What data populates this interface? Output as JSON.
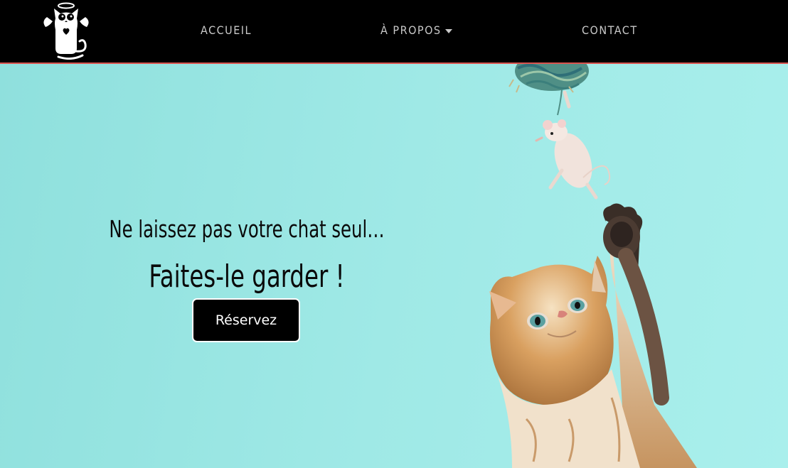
{
  "navbar": {
    "logo_icon": "angel-cat-logo-icon",
    "items": [
      {
        "label": "ACCUEIL"
      },
      {
        "label": "À PROPOS",
        "has_dropdown": true,
        "dropdown_icon": "caret-down-icon"
      },
      {
        "label": "CONTACT"
      }
    ]
  },
  "hero": {
    "tagline": "Ne laissez pas votre chat seul…",
    "headline": "Faites-le garder !",
    "cta_label": "Réservez",
    "image": "kitten-reaching-for-toy-mouse",
    "colors": {
      "background": "#95e3e0",
      "navbar": "#000000",
      "navbar_border": "#d9534f",
      "cta_background": "#000000",
      "cta_text": "#ffffff"
    }
  }
}
